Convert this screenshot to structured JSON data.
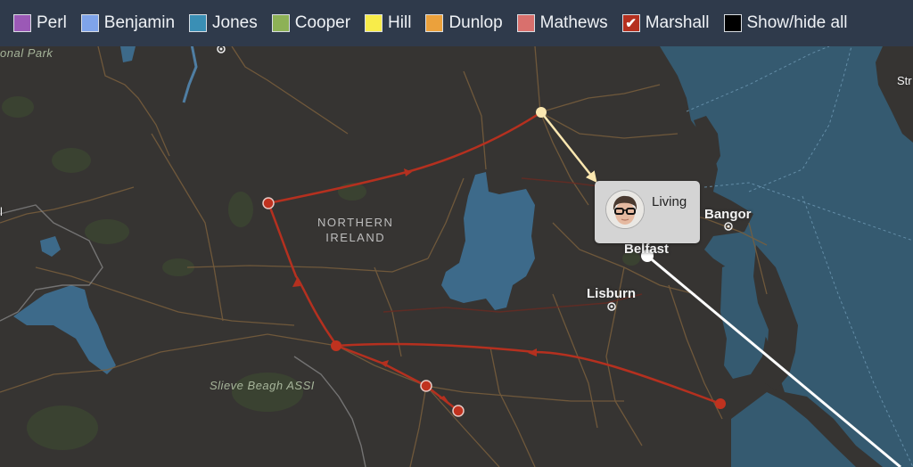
{
  "legend": {
    "items": [
      {
        "label": "Perl",
        "color": "#9b59b6",
        "checked": false
      },
      {
        "label": "Benjamin",
        "color": "#7fa4ea",
        "checked": false
      },
      {
        "label": "Jones",
        "color": "#3a8fb5",
        "checked": false
      },
      {
        "label": "Cooper",
        "color": "#8db156",
        "checked": false
      },
      {
        "label": "Hill",
        "color": "#f8ec4a",
        "checked": false
      },
      {
        "label": "Dunlop",
        "color": "#eba13c",
        "checked": false
      },
      {
        "label": "Mathews",
        "color": "#d9706d",
        "checked": false
      },
      {
        "label": "Marshall",
        "color": "#b5301f",
        "checked": true
      },
      {
        "label": "Show/hide all",
        "color": "#000000",
        "checked": false
      }
    ],
    "check_glyph": "✔"
  },
  "map": {
    "labels": {
      "park_top": "onal Park",
      "region_line1": "NORTHERN",
      "region_line2": "IRELAND",
      "slieve": "Slieve Beagh ASSI",
      "bangor": "Bangor",
      "belfast": "Belfast",
      "lisburn": "Lisburn",
      "strangford": "Str",
      "left_edge": "l"
    },
    "route_color": "#b5301f",
    "active_leg_color": "#fbe7b0",
    "current_leg_color": "#ffffff",
    "popup": {
      "text": "Living",
      "avatar": "person-avatar"
    }
  }
}
